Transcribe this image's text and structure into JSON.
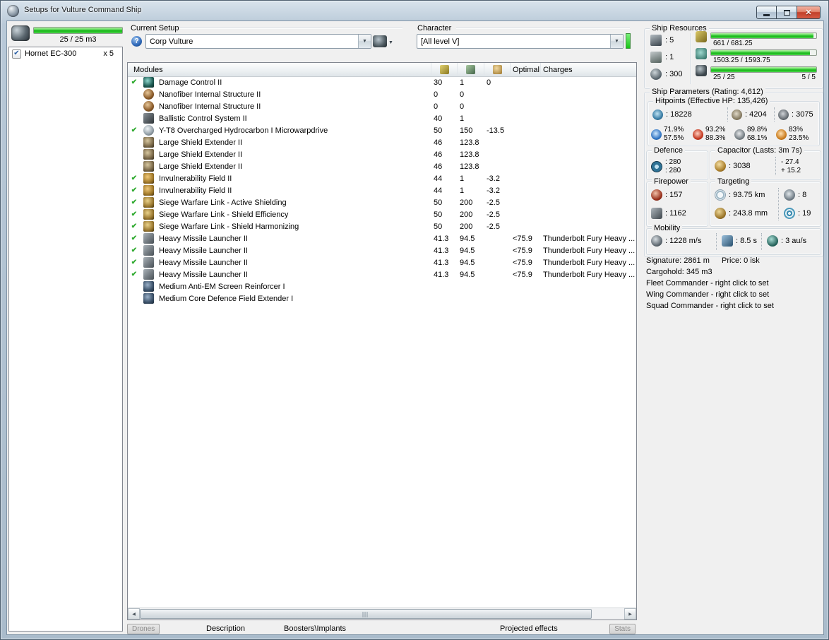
{
  "colors": {
    "progress_green": "#2ecc2e",
    "active_check_green": "#2faa2f",
    "close_button_red": "#cf4433",
    "character_skill_green": "#39d839"
  },
  "window": {
    "title": "Setups for Vulture Command Ship"
  },
  "drone_bay": {
    "capacity_text": "25 / 25 m3",
    "items": [
      {
        "name": "Hornet EC-300",
        "qty": "x 5",
        "checked": true
      }
    ]
  },
  "setup": {
    "current_setup_label": "Current Setup",
    "setup_name": "Corp Vulture",
    "character_label": "Character",
    "character_name": "[All level V]"
  },
  "modules": {
    "header": {
      "name": "Modules",
      "optimal": "Optimal",
      "charges": "Charges"
    },
    "rows": [
      {
        "active": true,
        "icon": "damage-control-icon",
        "name": "Damage Control II",
        "cpu": "30",
        "pg": "1",
        "cap": "0"
      },
      {
        "active": false,
        "icon": "nanofiber-structure-icon",
        "name": "Nanofiber Internal Structure II",
        "cpu": "0",
        "pg": "0"
      },
      {
        "active": false,
        "icon": "nanofiber-structure-icon",
        "name": "Nanofiber Internal Structure II",
        "cpu": "0",
        "pg": "0"
      },
      {
        "active": false,
        "icon": "ballistic-control-icon",
        "name": "Ballistic Control System II",
        "cpu": "40",
        "pg": "1"
      },
      {
        "active": true,
        "icon": "microwarpdrive-icon",
        "name": "Y-T8 Overcharged Hydrocarbon I Microwarpdrive",
        "cpu": "50",
        "pg": "150",
        "cap": "-13.5"
      },
      {
        "active": false,
        "icon": "shield-extender-icon",
        "name": "Large Shield Extender II",
        "cpu": "46",
        "pg": "123.8"
      },
      {
        "active": false,
        "icon": "shield-extender-icon",
        "name": "Large Shield Extender II",
        "cpu": "46",
        "pg": "123.8"
      },
      {
        "active": false,
        "icon": "shield-extender-icon",
        "name": "Large Shield Extender II",
        "cpu": "46",
        "pg": "123.8"
      },
      {
        "active": true,
        "icon": "invulnerability-field-icon",
        "name": "Invulnerability Field II",
        "cpu": "44",
        "pg": "1",
        "cap": "-3.2"
      },
      {
        "active": true,
        "icon": "invulnerability-field-icon",
        "name": "Invulnerability Field II",
        "cpu": "44",
        "pg": "1",
        "cap": "-3.2"
      },
      {
        "active": true,
        "icon": "siege-warfare-link-icon",
        "name": "Siege Warfare Link - Active Shielding",
        "cpu": "50",
        "pg": "200",
        "cap": "-2.5"
      },
      {
        "active": true,
        "icon": "siege-warfare-link-icon",
        "name": "Siege Warfare Link - Shield Efficiency",
        "cpu": "50",
        "pg": "200",
        "cap": "-2.5"
      },
      {
        "active": true,
        "icon": "siege-warfare-link-icon",
        "name": "Siege Warfare Link - Shield Harmonizing",
        "cpu": "50",
        "pg": "200",
        "cap": "-2.5"
      },
      {
        "active": true,
        "icon": "missile-launcher-icon",
        "name": "Heavy Missile Launcher II",
        "cpu": "41.3",
        "pg": "94.5",
        "optimal": "<75.9",
        "charges": "Thunderbolt Fury Heavy ..."
      },
      {
        "active": true,
        "icon": "missile-launcher-icon",
        "name": "Heavy Missile Launcher II",
        "cpu": "41.3",
        "pg": "94.5",
        "optimal": "<75.9",
        "charges": "Thunderbolt Fury Heavy ..."
      },
      {
        "active": true,
        "icon": "missile-launcher-icon",
        "name": "Heavy Missile Launcher II",
        "cpu": "41.3",
        "pg": "94.5",
        "optimal": "<75.9",
        "charges": "Thunderbolt Fury Heavy ..."
      },
      {
        "active": true,
        "icon": "missile-launcher-icon",
        "name": "Heavy Missile Launcher II",
        "cpu": "41.3",
        "pg": "94.5",
        "optimal": "<75.9",
        "charges": "Thunderbolt Fury Heavy ..."
      },
      {
        "active": false,
        "icon": "shield-rig-icon",
        "name": "Medium Anti-EM Screen Reinforcer I"
      },
      {
        "active": false,
        "icon": "shield-rig-icon",
        "name": "Medium Core Defence Field Extender I"
      }
    ]
  },
  "bottom_tabs": {
    "drones": "Drones",
    "description": "Description",
    "boosters": "Boosters\\Implants",
    "projected": "Projected effects",
    "stats": "Stats"
  },
  "ship_resources": {
    "title": "Ship Resources",
    "turret_hardpoints": ": 5",
    "launcher_hardpoints": ": 1",
    "calibration": ": 300",
    "cpu": {
      "icon": "cpu-icon",
      "text": "661 / 681.25",
      "pct": 97
    },
    "powergrid": {
      "icon": "powergrid-icon",
      "text": "1503.25 / 1593.75",
      "pct": 94
    },
    "dronebay": {
      "icon": "drone-bandwidth-icon",
      "text": "25 / 25",
      "right_text": "5 / 5",
      "pct": 100
    }
  },
  "ship_parameters": {
    "title": "Ship Parameters (Rating: 4,612)",
    "hitpoints": {
      "title": "Hitpoints (Effective HP: 135,426)",
      "shield": ": 18228",
      "armor": ": 4204",
      "structure": ": 3075",
      "resists": [
        {
          "icon": "em-resist-icon",
          "shield_pct": "71.9%",
          "armor_pct": "57.5%"
        },
        {
          "icon": "thermal-resist-icon",
          "shield_pct": "93.2%",
          "armor_pct": "88.3%"
        },
        {
          "icon": "kinetic-resist-icon",
          "shield_pct": "89.8%",
          "armor_pct": "68.1%"
        },
        {
          "icon": "explosive-resist-icon",
          "shield_pct": "83%",
          "armor_pct": "23.5%"
        }
      ]
    },
    "defence": {
      "title": "Defence",
      "value_top": ": 280",
      "value_bottom": ": 280"
    },
    "capacitor": {
      "title": "Capacitor (Lasts: 3m 7s)",
      "amount": ": 3038",
      "delta_out": "- 27.4",
      "delta_in": "+ 15.2"
    },
    "firepower": {
      "title": "Firepower",
      "dps": ": 157",
      "volley": ": 1162"
    },
    "targeting": {
      "title": "Targeting",
      "range": ": 93.75 km",
      "max_targets": ": 8",
      "scan_resolution": ": 243.8 mm",
      "sensor_strength": ": 19"
    },
    "mobility": {
      "title": "Mobility",
      "max_velocity": ": 1228 m/s",
      "align_time": ": 8.5 s",
      "warp_speed": ": 3 au/s"
    }
  },
  "info": {
    "signature": "Signature: 2861 m",
    "price": "Price: 0 isk",
    "cargohold": "Cargohold: 345 m3",
    "fleet_commander": "Fleet Commander - right click to set",
    "wing_commander": "Wing Commander - right click to set",
    "squad_commander": "Squad Commander - right click to set"
  }
}
